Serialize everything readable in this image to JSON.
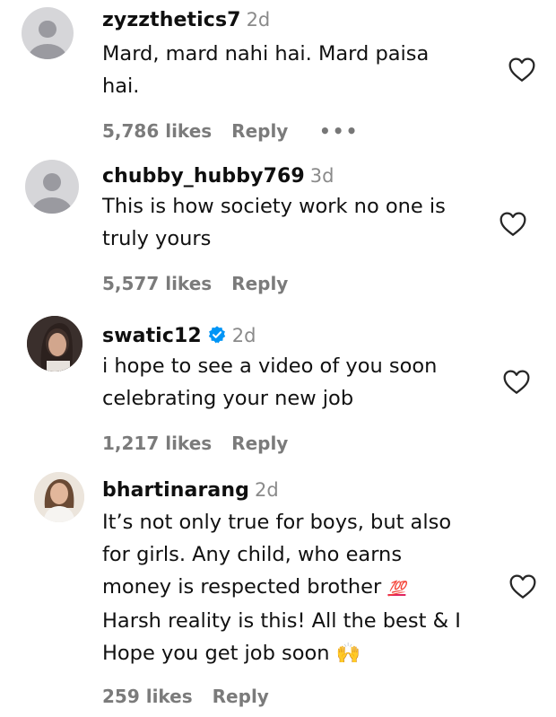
{
  "comments": [
    {
      "username": "zyzzthetics7",
      "time": "2d",
      "text": "Mard, mard nahi hai. Mard paisa\nhai.",
      "likes": "5,786 likes",
      "reply": "Reply",
      "more": "•••",
      "avatar": "default-avatar"
    },
    {
      "username": "chubby_hubby769",
      "time": "3d",
      "text": "This is how society work no one is\ntruly yours",
      "likes": "5,577 likes",
      "reply": "Reply",
      "avatar": "default-avatar"
    },
    {
      "username": "swatic12",
      "time": "2d",
      "verified": true,
      "text": "i hope to see a video of you soon\ncelebrating your new job",
      "likes": "1,217 likes",
      "reply": "Reply",
      "avatar": "photo-avatar"
    },
    {
      "username": "bhartinarang",
      "time": "2d",
      "text_lines": [
        "It’s not only true for boys, but also",
        "for girls. Any child, who earns",
        "money is respected brother",
        "Harsh reality is this! All the best & I",
        "Hope you get job soon"
      ],
      "emoji_100": "💯",
      "emoji_hands": "🙌",
      "likes": "259 likes",
      "reply": "Reply",
      "avatar": "photo-avatar"
    }
  ],
  "colors": {
    "username": "#0f0f0f",
    "meta": "#7b7b7b",
    "verified": "#0095f6",
    "heart_stroke": "#262626"
  },
  "icons": [
    "heart-icon",
    "verified-badge-icon",
    "more-options-icon"
  ]
}
